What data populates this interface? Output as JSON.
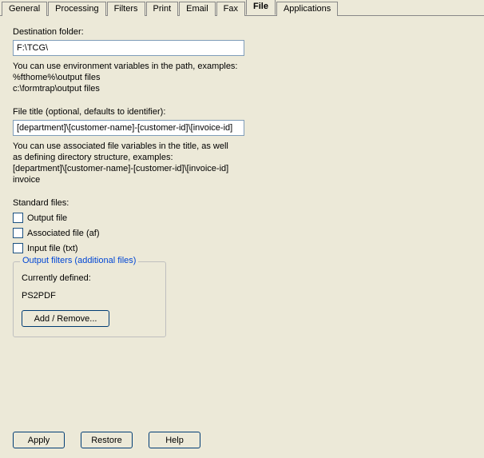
{
  "tabs": {
    "general": "General",
    "processing": "Processing",
    "filters": "Filters",
    "print": "Print",
    "email": "Email",
    "fax": "Fax",
    "file": "File",
    "applications": "Applications"
  },
  "destination": {
    "label": "Destination folder:",
    "value": "F:\\TCG\\",
    "hint_line1": "You can use environment variables in the path, examples:",
    "hint_line2": "%fthome%\\output files",
    "hint_line3": "c:\\formtrap\\output files"
  },
  "filetitle": {
    "label": "File title (optional, defaults to identifier):",
    "value": "[department]\\[customer-name]-[customer-id]\\[invoice-id]",
    "hint_line1": "You can use associated file variables in the title, as well",
    "hint_line2": "as defining directory structure, examples:",
    "hint_line3": "[department]\\[customer-name]-[customer-id]\\[invoice-id]",
    "hint_line4": "invoice"
  },
  "standard": {
    "label": "Standard files:",
    "output": "Output file",
    "associated": "Associated file (af)",
    "input": "Input file (txt)"
  },
  "filters_group": {
    "legend": "Output filters (additional files)",
    "defined_label": "Currently defined:",
    "defined_value": "PS2PDF",
    "add_remove": "Add / Remove..."
  },
  "buttons": {
    "apply": "Apply",
    "restore": "Restore",
    "help": "Help"
  }
}
